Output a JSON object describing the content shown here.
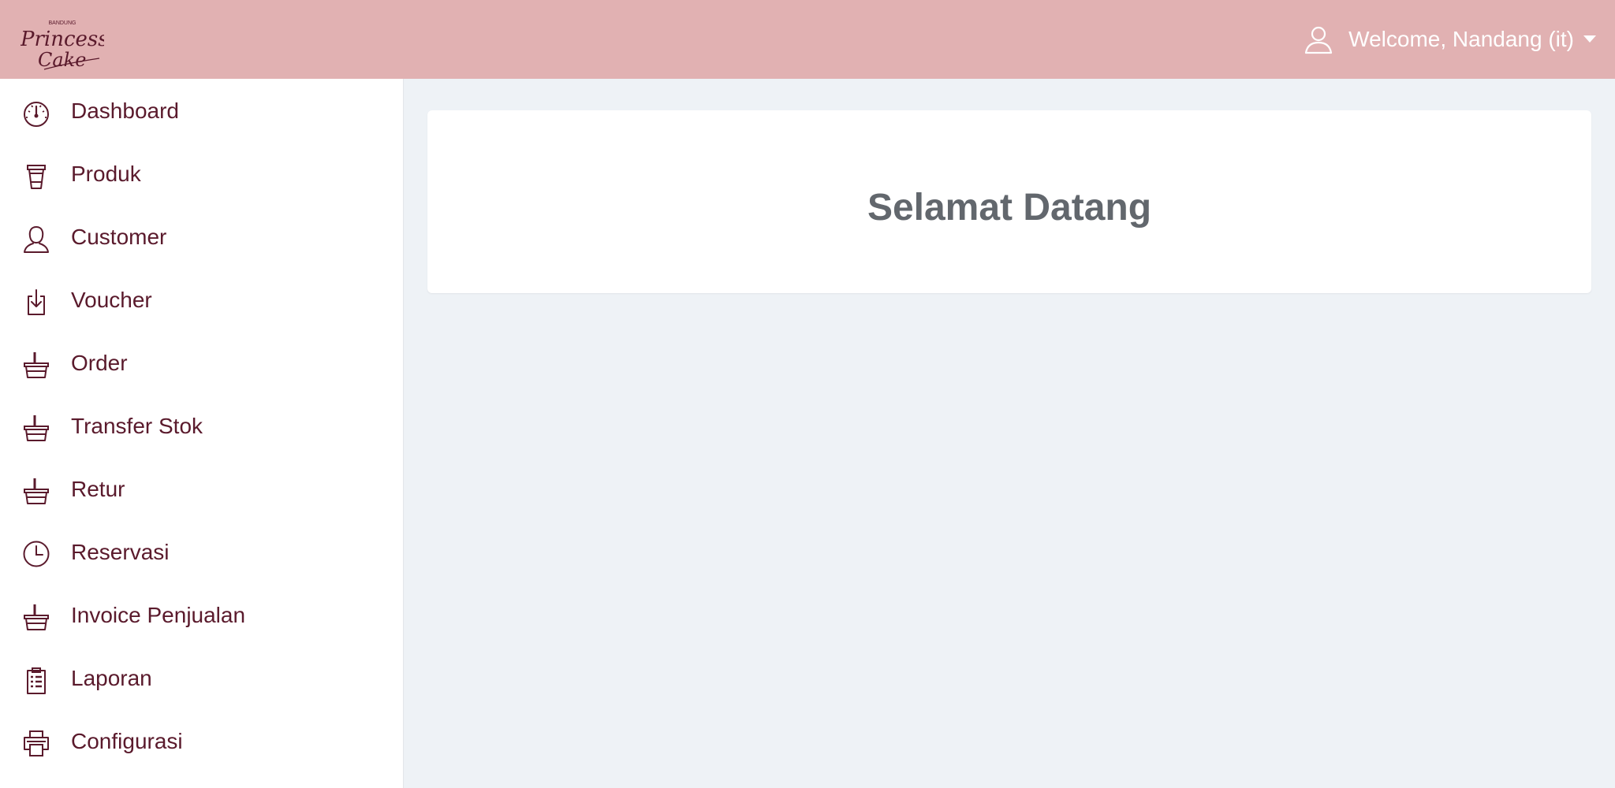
{
  "colors": {
    "header_bg": "#e1b1b2",
    "nav_text": "#5a1a2c",
    "page_bg": "#eef2f6",
    "card_bg": "#ffffff",
    "title_text": "#62676d"
  },
  "header": {
    "logo": {
      "top_text": "BANDUNG",
      "line1": "Princess",
      "line2": "Cake"
    },
    "user_menu": {
      "welcome": "Welcome, Nandang (it)",
      "icon": "user-icon",
      "caret": "caret-down-icon"
    }
  },
  "sidebar": {
    "items": [
      {
        "label": "Dashboard",
        "icon": "dashboard-gauge-icon"
      },
      {
        "label": "Produk",
        "icon": "cup-icon"
      },
      {
        "label": "Customer",
        "icon": "person-icon"
      },
      {
        "label": "Voucher",
        "icon": "download-box-icon"
      },
      {
        "label": "Order",
        "icon": "basket-icon"
      },
      {
        "label": "Transfer Stok",
        "icon": "basket-icon"
      },
      {
        "label": "Retur",
        "icon": "basket-icon"
      },
      {
        "label": "Reservasi",
        "icon": "clock-icon"
      },
      {
        "label": "Invoice Penjualan",
        "icon": "basket-icon"
      },
      {
        "label": "Laporan",
        "icon": "clipboard-list-icon"
      },
      {
        "label": "Configurasi",
        "icon": "printer-icon"
      }
    ]
  },
  "main": {
    "welcome_title": "Selamat Datang"
  }
}
